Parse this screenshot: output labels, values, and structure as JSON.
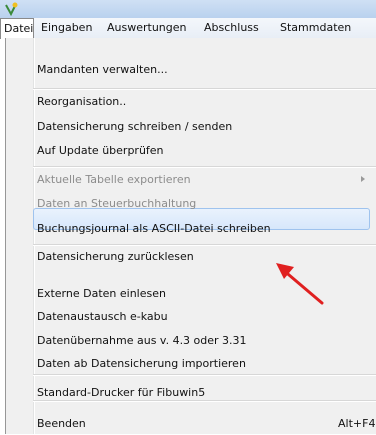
{
  "menubar": {
    "items": [
      "Datei",
      "Eingaben",
      "Auswertungen",
      "Abschluss",
      "Stammdaten"
    ]
  },
  "menu": {
    "items": [
      "Mandanten  verwalten...",
      "Reorganisation..",
      "Datensicherung schreiben / senden",
      "Auf Update überprüfen",
      "Aktuelle Tabelle exportieren",
      "Daten an Steuerbuchhaltung",
      "Buchungsjournal als ASCII-Datei schreiben",
      "Datensicherung zurücklesen",
      "Externe Daten einlesen",
      "Datenaustausch e-kabu",
      "Datenübernahme aus v. 4.3 oder 3.31",
      "Daten ab Datensicherung  importieren",
      "Standard-Drucker für Fibuwin5",
      "Beenden"
    ],
    "beenden_shortcut": "Alt+F4",
    "highlighted_item": "Datensicherung zurücklesen",
    "disabled_items": [
      "Aktuelle Tabelle exportieren",
      "Daten an Steuerbuchhaltung"
    ]
  },
  "colors": {
    "highlight_fill": "#dce9fb",
    "highlight_border": "#9fc3ee",
    "annotation_arrow": "#e02020"
  },
  "icons": {
    "app": "app-icon",
    "submenu": "submenu-arrow-icon",
    "annotation": "red-arrow-annotation"
  }
}
